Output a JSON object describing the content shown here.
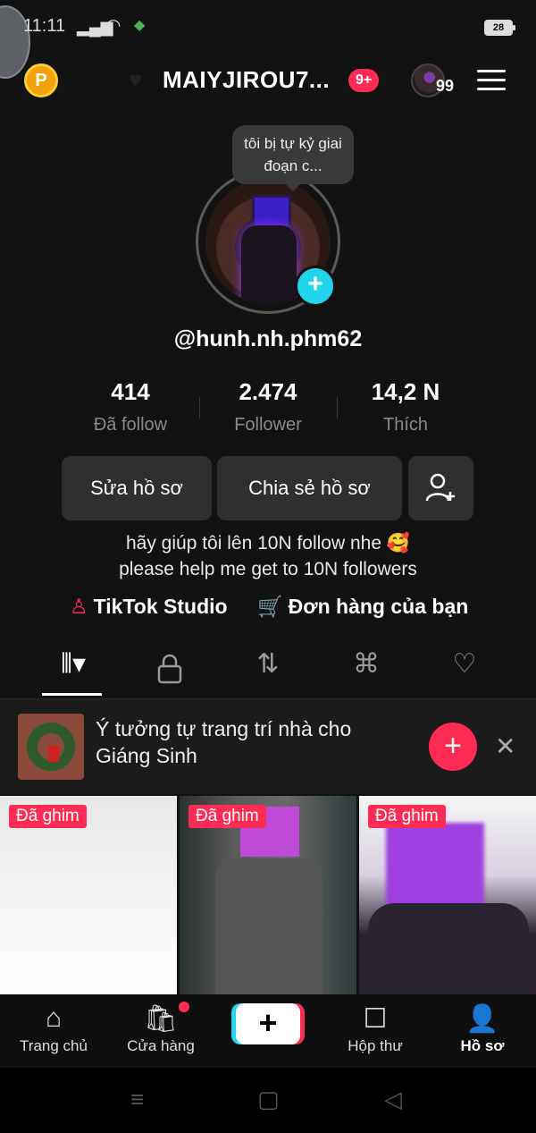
{
  "status_bar": {
    "time": "11:11",
    "battery": "28"
  },
  "header": {
    "coin_label": "P",
    "username": "MAIYJIROU7...",
    "notification_badge": "9+",
    "avatar_count": "99"
  },
  "profile": {
    "note": "tôi bị tự kỷ giai đoạn c...",
    "handle": "@hunh.nh.phm62",
    "stats": [
      {
        "value": "414",
        "label": "Đã follow"
      },
      {
        "value": "2.474",
        "label": "Follower"
      },
      {
        "value": "14,2 N",
        "label": "Thích"
      }
    ],
    "edit_button": "Sửa hồ sơ",
    "share_button": "Chia sẻ hồ sơ",
    "bio_line1": "hãy giúp tôi lên 10N follow nhe 🥰",
    "bio_line2": "please help me get to 10N followers",
    "link_studio": "TikTok Studio",
    "link_orders": "Đơn hàng của bạn"
  },
  "suggestion": {
    "text": "Ý tưởng tự trang trí nhà cho Giáng Sinh"
  },
  "videos": [
    {
      "pinned_label": "Đã ghim"
    },
    {
      "pinned_label": "Đã ghim"
    },
    {
      "pinned_label": "Đã ghim"
    }
  ],
  "bottom_nav": [
    {
      "label": "Trang chủ",
      "icon": "home-icon"
    },
    {
      "label": "Cửa hàng",
      "icon": "shop-icon"
    },
    {
      "label": "",
      "icon": "create-icon"
    },
    {
      "label": "Hộp thư",
      "icon": "inbox-icon"
    },
    {
      "label": "Hồ sơ",
      "icon": "profile-icon"
    }
  ],
  "colors": {
    "accent": "#fe2c55",
    "cyan": "#20d5ec",
    "background": "#121212"
  }
}
